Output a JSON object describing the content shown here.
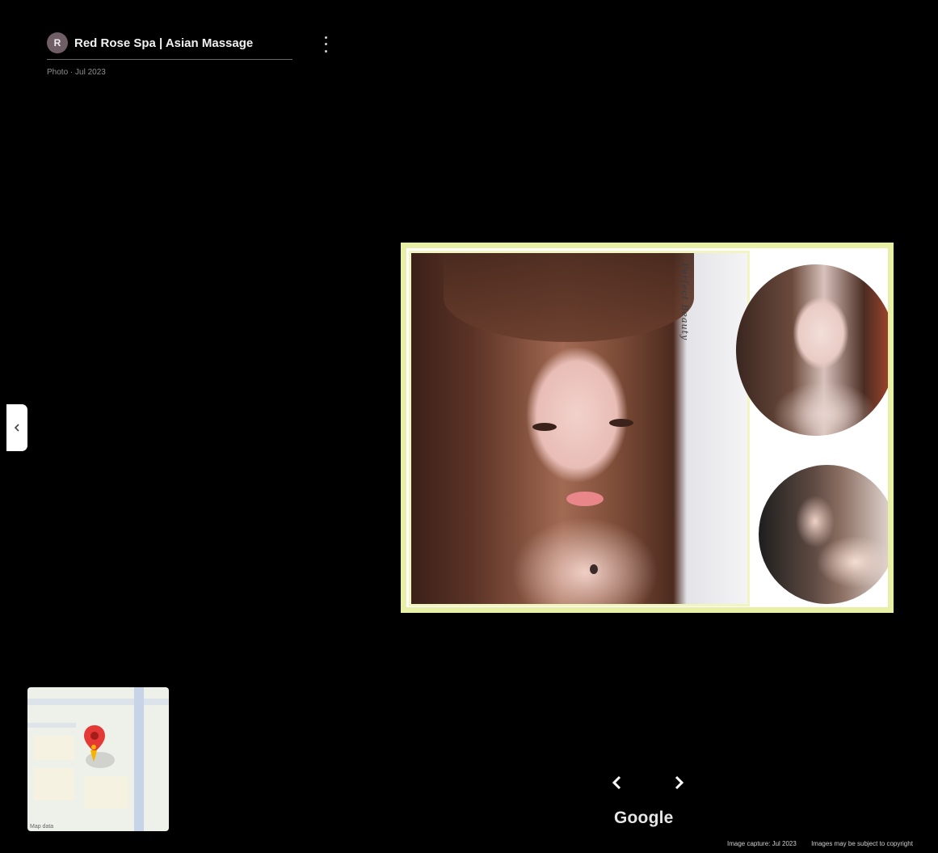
{
  "header": {
    "avatar_initial": "R",
    "title": "Red Rose Spa | Asian Massage",
    "subtitle": "Photo · Jul 2023"
  },
  "photo": {
    "signature_text": "Perfect Beauty"
  },
  "minimap": {
    "attribution": "Map data"
  },
  "navigation": {
    "prev_glyph": "‹",
    "next_glyph": "›"
  },
  "brand": {
    "logo_text": "Google"
  },
  "footer": {
    "capture_text": "Image capture: Jul 2023",
    "notice_text": "Images may be subject to copyright"
  },
  "colors": {
    "background": "#000000",
    "photo_border": "#e7f0a6",
    "pin_red": "#e53935",
    "pegman_yellow": "#f4b400"
  },
  "icons": {
    "menu": "kebab-menu-icon",
    "collapse": "chevron-left-icon",
    "pin": "map-pin-icon",
    "pegman": "pegman-icon"
  }
}
